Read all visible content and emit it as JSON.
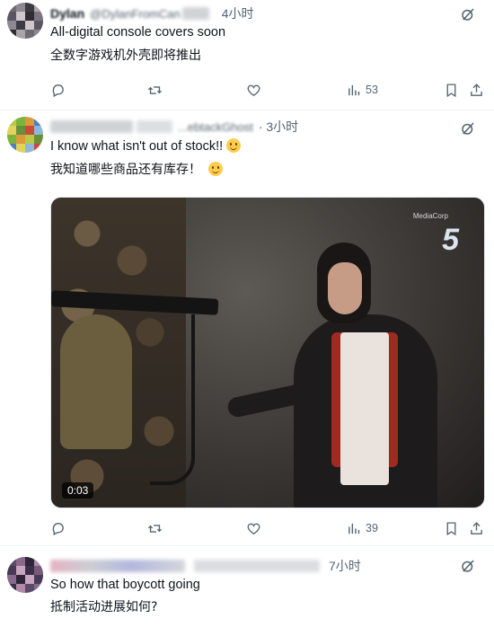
{
  "posts": [
    {
      "display_name": "Dylan",
      "handle": "@DylanFromCan",
      "time": "4小时",
      "text_en": "All-digital console covers soon",
      "text_cn": "全数字游戏机外壳即将推出",
      "views": "53",
      "avatar_colors": [
        "#6d6a74",
        "#8e8794",
        "#3c3a42",
        "#aaa3a8",
        "#5a5560",
        "#cfc7cc",
        "#2f2c33",
        "#7c7480"
      ]
    },
    {
      "handle": "...ebtackGhost",
      "time": "· 3小时",
      "text_en": "I know what isn't out of stock!!",
      "text_cn": "我知道哪些商品还有库存！",
      "views": "39",
      "video_duration": "0:03",
      "video_logo": "5",
      "video_logo_tag": "MediaCorp",
      "avatar_colors": [
        "#b8c94a",
        "#7bb33c",
        "#d99b3b",
        "#4f7fc2",
        "#e2d35a",
        "#6a8e3b",
        "#c84a3a",
        "#8fb7d9"
      ]
    },
    {
      "time": "7小时",
      "text_en": "So how that boycott going",
      "text_cn": "抵制活动进展如何?",
      "avatar_colors": [
        "#5b4a6a",
        "#8a6a8a",
        "#2e2538",
        "#b08aa8",
        "#463a55",
        "#c9a6bf",
        "#3a2f46",
        "#7a5a7a"
      ]
    }
  ],
  "icons": {
    "reply": "reply-icon",
    "repost": "repost-icon",
    "like": "like-icon",
    "views": "views-icon",
    "bookmark": "bookmark-icon",
    "share": "share-icon",
    "grok": "grok-icon"
  }
}
